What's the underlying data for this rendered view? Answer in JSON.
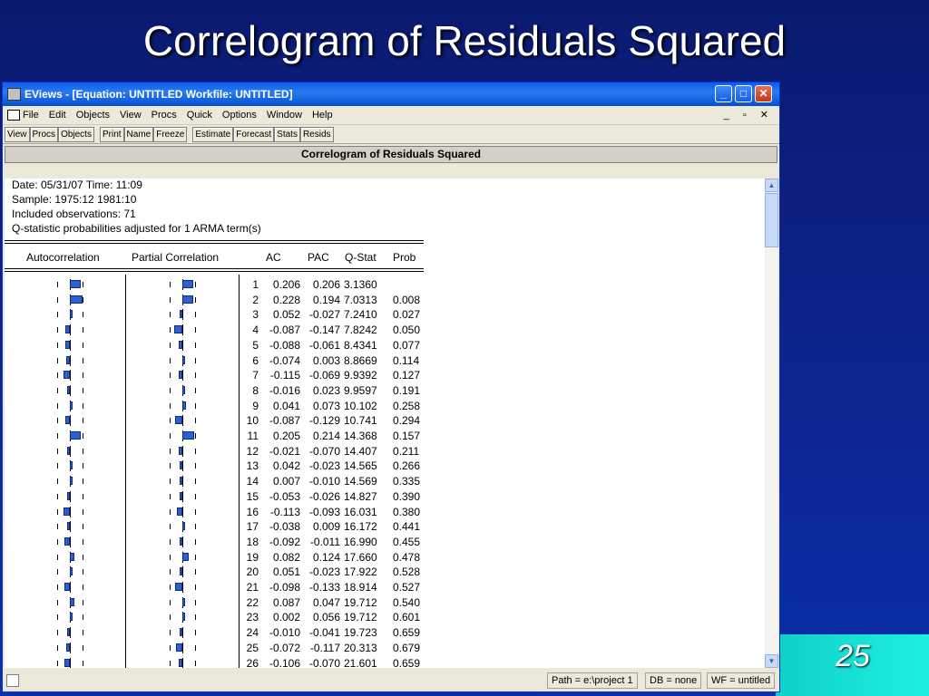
{
  "slide": {
    "title": "Correlogram of Residuals Squared",
    "page_number": "25"
  },
  "window": {
    "title": "EViews - [Equation: UNTITLED   Workfile: UNTITLED]",
    "menu": [
      "File",
      "Edit",
      "Objects",
      "View",
      "Procs",
      "Quick",
      "Options",
      "Window",
      "Help"
    ],
    "toolbar": [
      "View",
      "Procs",
      "Objects",
      "Print",
      "Name",
      "Freeze",
      "Estimate",
      "Forecast",
      "Stats",
      "Resids"
    ],
    "header": "Correlogram of Residuals Squared"
  },
  "info": {
    "date": "Date: 05/31/07   Time: 11:09",
    "sample": "Sample: 1975:12 1981:10",
    "obs": "Included observations: 71",
    "note": "Q-statistic probabilities adjusted for 1 ARMA term(s)"
  },
  "columns": {
    "ac_chart": "Autocorrelation",
    "pac_chart": "Partial Correlation",
    "ac": "AC",
    "pac": "PAC",
    "q": "Q-Stat",
    "prob": "Prob"
  },
  "rows": [
    {
      "lag": "1",
      "ac": "0.206",
      "pac": "0.206",
      "q": "3.1360",
      "prob": ""
    },
    {
      "lag": "2",
      "ac": "0.228",
      "pac": "0.194",
      "q": "7.0313",
      "prob": "0.008"
    },
    {
      "lag": "3",
      "ac": "0.052",
      "pac": "-0.027",
      "q": "7.2410",
      "prob": "0.027"
    },
    {
      "lag": "4",
      "ac": "-0.087",
      "pac": "-0.147",
      "q": "7.8242",
      "prob": "0.050"
    },
    {
      "lag": "5",
      "ac": "-0.088",
      "pac": "-0.061",
      "q": "8.4341",
      "prob": "0.077"
    },
    {
      "lag": "6",
      "ac": "-0.074",
      "pac": "0.003",
      "q": "8.8669",
      "prob": "0.114"
    },
    {
      "lag": "7",
      "ac": "-0.115",
      "pac": "-0.069",
      "q": "9.9392",
      "prob": "0.127"
    },
    {
      "lag": "8",
      "ac": "-0.016",
      "pac": "0.023",
      "q": "9.9597",
      "prob": "0.191"
    },
    {
      "lag": "9",
      "ac": "0.041",
      "pac": "0.073",
      "q": "10.102",
      "prob": "0.258"
    },
    {
      "lag": "10",
      "ac": "-0.087",
      "pac": "-0.129",
      "q": "10.741",
      "prob": "0.294"
    },
    {
      "lag": "11",
      "ac": "0.205",
      "pac": "0.214",
      "q": "14.368",
      "prob": "0.157"
    },
    {
      "lag": "12",
      "ac": "-0.021",
      "pac": "-0.070",
      "q": "14.407",
      "prob": "0.211"
    },
    {
      "lag": "13",
      "ac": "0.042",
      "pac": "-0.023",
      "q": "14.565",
      "prob": "0.266"
    },
    {
      "lag": "14",
      "ac": "0.007",
      "pac": "-0.010",
      "q": "14.569",
      "prob": "0.335"
    },
    {
      "lag": "15",
      "ac": "-0.053",
      "pac": "-0.026",
      "q": "14.827",
      "prob": "0.390"
    },
    {
      "lag": "16",
      "ac": "-0.113",
      "pac": "-0.093",
      "q": "16.031",
      "prob": "0.380"
    },
    {
      "lag": "17",
      "ac": "-0.038",
      "pac": "0.009",
      "q": "16.172",
      "prob": "0.441"
    },
    {
      "lag": "18",
      "ac": "-0.092",
      "pac": "-0.011",
      "q": "16.990",
      "prob": "0.455"
    },
    {
      "lag": "19",
      "ac": "0.082",
      "pac": "0.124",
      "q": "17.660",
      "prob": "0.478"
    },
    {
      "lag": "20",
      "ac": "0.051",
      "pac": "-0.023",
      "q": "17.922",
      "prob": "0.528"
    },
    {
      "lag": "21",
      "ac": "-0.098",
      "pac": "-0.133",
      "q": "18.914",
      "prob": "0.527"
    },
    {
      "lag": "22",
      "ac": "0.087",
      "pac": "0.047",
      "q": "19.712",
      "prob": "0.540"
    },
    {
      "lag": "23",
      "ac": "0.002",
      "pac": "0.056",
      "q": "19.712",
      "prob": "0.601"
    },
    {
      "lag": "24",
      "ac": "-0.010",
      "pac": "-0.041",
      "q": "19.723",
      "prob": "0.659"
    },
    {
      "lag": "25",
      "ac": "-0.072",
      "pac": "-0.117",
      "q": "20.313",
      "prob": "0.679"
    },
    {
      "lag": "26",
      "ac": "-0.106",
      "pac": "-0.070",
      "q": "21.601",
      "prob": "0.659"
    }
  ],
  "status": {
    "path": "Path = e:\\project 1",
    "db": "DB = none",
    "wf": "WF = untitled"
  },
  "colors": {
    "bar": "#2a60d0",
    "title_bg": "#0a5ee8"
  }
}
